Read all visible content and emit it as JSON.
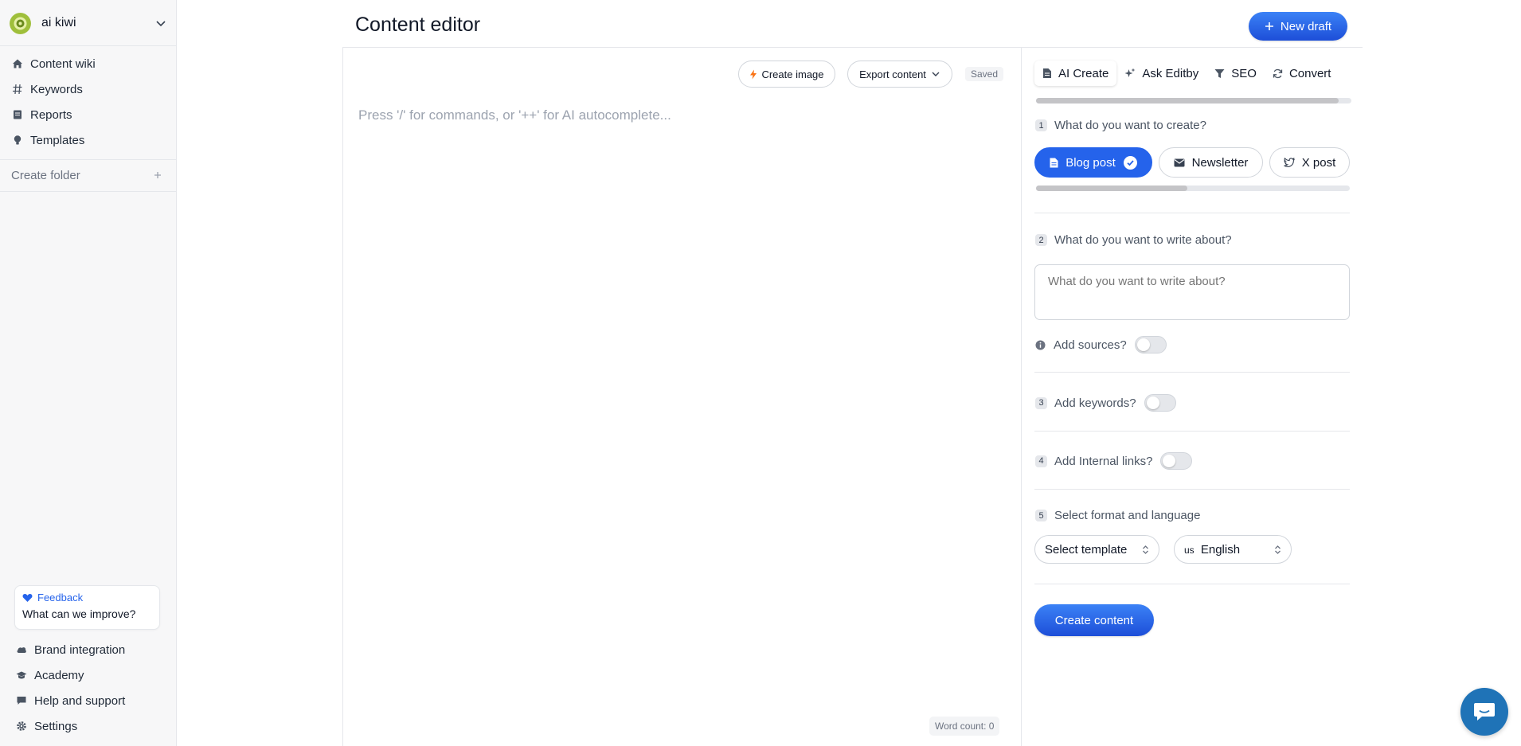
{
  "workspace": {
    "name": "ai kiwi"
  },
  "sidebar": {
    "items": [
      {
        "label": "Content wiki",
        "icon": "home-icon"
      },
      {
        "label": "Keywords",
        "icon": "hash-icon"
      },
      {
        "label": "Reports",
        "icon": "report-icon"
      },
      {
        "label": "Templates",
        "icon": "bulb-icon"
      }
    ],
    "create_folder": "Create folder",
    "feedback": {
      "title": "Feedback",
      "text": "What can we improve?"
    },
    "bottom_items": [
      {
        "label": "Brand integration",
        "icon": "cloud-icon"
      },
      {
        "label": "Academy",
        "icon": "graduation-cap-icon"
      },
      {
        "label": "Help and support",
        "icon": "chat-bubble-icon"
      },
      {
        "label": "Settings",
        "icon": "gear-icon"
      }
    ]
  },
  "header": {
    "title": "Content editor",
    "new_draft": "New draft"
  },
  "editor": {
    "create_image": "Create image",
    "export_content": "Export content",
    "saved": "Saved",
    "placeholder": "Press '/' for commands, or '++' for AI autocomplete...",
    "word_count": "Word count: 0"
  },
  "panel": {
    "tabs": [
      {
        "label": "AI Create",
        "icon": "document-icon",
        "active": true
      },
      {
        "label": "Ask Editby",
        "icon": "sparkle-icon"
      },
      {
        "label": "SEO",
        "icon": "funnel-icon"
      },
      {
        "label": "Convert",
        "icon": "refresh-icon"
      }
    ],
    "step1": {
      "num": "1",
      "label": "What do you want to create?"
    },
    "types": [
      {
        "label": "Blog post",
        "selected": true
      },
      {
        "label": "Newsletter"
      },
      {
        "label": "X post"
      }
    ],
    "step2": {
      "num": "2",
      "label": "What do you want to write about?",
      "placeholder": "What do you want to write about?"
    },
    "sources": {
      "label": "Add sources?"
    },
    "step3": {
      "num": "3",
      "label": "Add keywords?"
    },
    "step4": {
      "num": "4",
      "label": "Add Internal links?"
    },
    "step5": {
      "num": "5",
      "label": "Select format and language"
    },
    "template_select": "Select template",
    "language": {
      "flag": "us",
      "label": "English"
    },
    "create_content": "Create content"
  },
  "colors": {
    "accent": "#2563eb",
    "fab": "#1f73b7",
    "logo": "#a7c34a"
  }
}
